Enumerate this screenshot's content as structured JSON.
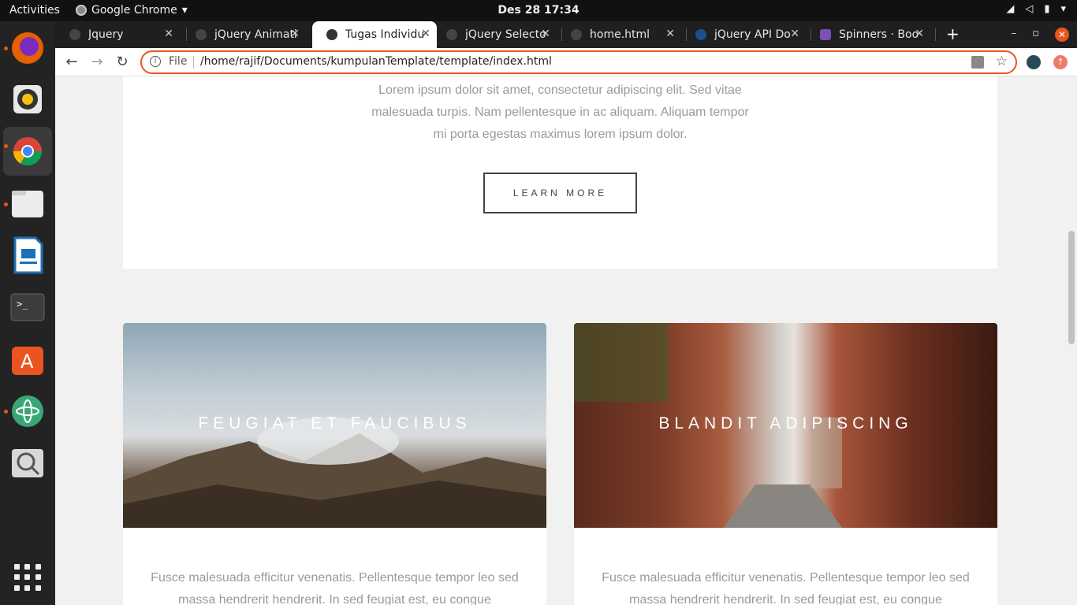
{
  "topbar": {
    "activities": "Activities",
    "app_name": "Google Chrome",
    "clock": "Des 28  17:34"
  },
  "tabs": [
    {
      "title": "Jquery",
      "active": false
    },
    {
      "title": "jQuery Animati",
      "active": false
    },
    {
      "title": "Tugas Individu",
      "active": true
    },
    {
      "title": "jQuery Selecto",
      "active": false
    },
    {
      "title": "home.html",
      "active": false
    },
    {
      "title": "jQuery API Do",
      "active": false
    },
    {
      "title": "Spinners · Boo",
      "active": false
    }
  ],
  "omnibox": {
    "scheme": "File",
    "url": "/home/rajif/Documents/kumpulanTemplate/template/index.html"
  },
  "page": {
    "lorem": "Lorem ipsum dolor sit amet, consectetur adipiscing elit. Sed vitae malesuada turpis. Nam pellentesque in ac aliquam. Aliquam tempor mi porta egestas maximus lorem ipsum dolor.",
    "learn_more": "LEARN MORE",
    "features": [
      {
        "title": "FEUGIAT ET FAUCIBUS",
        "desc": "Fusce malesuada efficitur venenatis. Pellentesque tempor leo sed massa hendrerit hendrerit. In sed feugiat est, eu congue"
      },
      {
        "title": "BLANDIT ADIPISCING",
        "desc": "Fusce malesuada efficitur venenatis. Pellentesque tempor leo sed massa hendrerit hendrerit. In sed feugiat est, eu congue"
      }
    ]
  }
}
